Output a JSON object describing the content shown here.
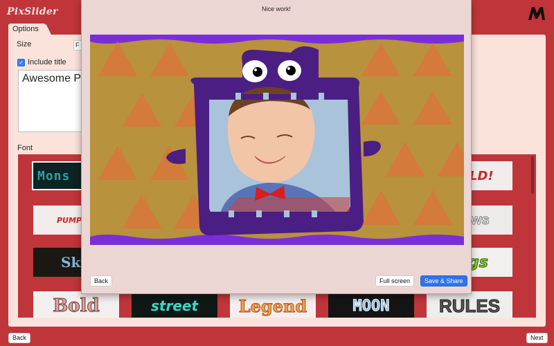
{
  "app": {
    "name": "PixSlider"
  },
  "options_tab": "Options",
  "size": {
    "label": "Size",
    "value": "F"
  },
  "include_title": {
    "label": "Include title",
    "checked": true
  },
  "title_field": {
    "value": "Awesome P"
  },
  "font": {
    "label": "Font"
  },
  "font_tiles": [
    {
      "name": "monster",
      "text": "Mons",
      "color": "#2aa1a0"
    },
    {
      "name": "scribble-red",
      "text": "PUMP",
      "color": "#d52020"
    },
    {
      "name": "sky",
      "text": "Sk",
      "color": "#7fb7e0"
    },
    {
      "name": "bold",
      "text": "Bold",
      "color": "#d9a3a0"
    },
    {
      "name": "street",
      "text": "street",
      "color": "#3ad8c8"
    },
    {
      "name": "legend",
      "text": "Legend",
      "color": "#f0a04a"
    },
    {
      "name": "moon",
      "text": "MOON",
      "color": "#8fc0e8"
    },
    {
      "name": "rules",
      "text": "RULES",
      "color": "#555555"
    },
    {
      "name": "wild",
      "text": "LD!",
      "color": "#c82a2a"
    },
    {
      "name": "news",
      "text": "ws",
      "color": "#ffffff"
    },
    {
      "name": "gs",
      "text": "gs",
      "color": "#8ad12a"
    }
  ],
  "modal": {
    "title": "Nice work!",
    "back_label": "Back",
    "fullscreen_label": "Full screen",
    "save_label": "Save & Share"
  },
  "footer": {
    "back_label": "Back",
    "next_label": "Next"
  },
  "colors": {
    "background": "#c0353a",
    "panel": "#fbe3dc",
    "primary_button": "#2f73f0",
    "monster_purple": "#4b1e84",
    "preview_bg": "#b8923c"
  }
}
